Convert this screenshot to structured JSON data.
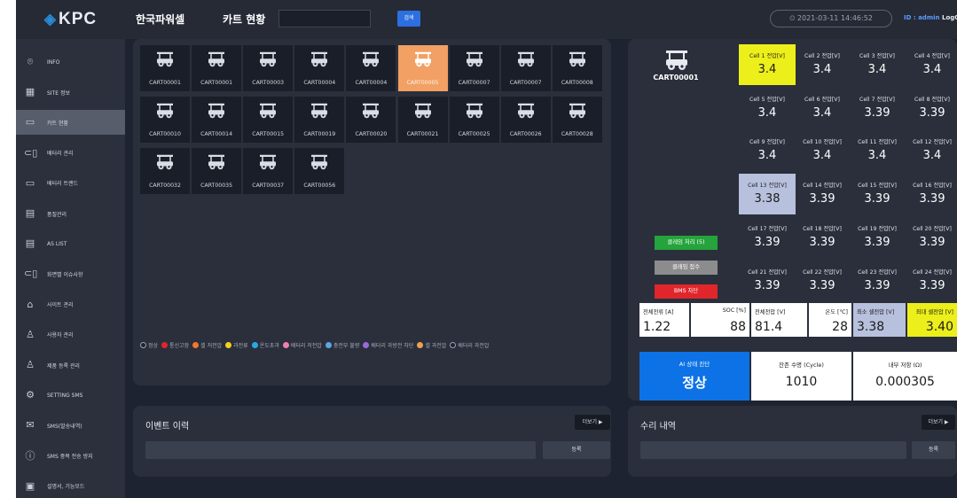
{
  "sidebar": {
    "logo": "KPC",
    "items": [
      {
        "label": "INFO",
        "icon": "location-pin-icon"
      },
      {
        "label": "SITE 정보",
        "icon": "building-icon"
      },
      {
        "label": "카트 현황",
        "icon": "monitor-icon"
      },
      {
        "label": "배터리 관리",
        "icon": "battery-signal-icon"
      },
      {
        "label": "배터리 트랜드",
        "icon": "battery-icon"
      },
      {
        "label": "품질관리",
        "icon": "clipboard-icon"
      },
      {
        "label": "AS LIST",
        "icon": "clipboard-list-icon"
      },
      {
        "label": "화면별 이슈사항",
        "icon": "battery-signal-icon"
      },
      {
        "label": "사이트 관리",
        "icon": "bank-icon"
      },
      {
        "label": "사용자 관리",
        "icon": "user-icon"
      },
      {
        "label": "제품 등록 관리",
        "icon": "user-edit-icon"
      },
      {
        "label": "SETTING SMS",
        "icon": "gear-icon"
      },
      {
        "label": "SMS(발송내역)",
        "icon": "mail-icon"
      },
      {
        "label": "SMS 중복 전송 방지",
        "icon": "info-circle-icon"
      },
      {
        "label": "설명서, 기능모드",
        "icon": "document-icon"
      }
    ]
  },
  "header": {
    "company": "한국파워셀",
    "page": "카트 현황",
    "search_value": "",
    "search_button": "검색",
    "datetime": "2021-03-11 14:46:52",
    "user": "ID : admin",
    "logout": "LogOut"
  },
  "carts": [
    "CART00001",
    "CART00001",
    "CART00003",
    "CART00004",
    "CART00004",
    "CART00005",
    "CART00007",
    "CART00007",
    "CART00008",
    "CART00010",
    "CART00014",
    "CART00015",
    "CART00019",
    "CART00020",
    "CART00021",
    "CART00025",
    "CART00026",
    "CART00028",
    "CART00032",
    "CART00035",
    "CART00037",
    "CART00056"
  ],
  "selected_cart_index": 5,
  "legend": [
    {
      "label": "정상",
      "color": "#1d2330",
      "border": "#9aa2b1"
    },
    {
      "label": "통신고장",
      "color": "#e0262b"
    },
    {
      "label": "셀 저전압",
      "color": "#f0782f"
    },
    {
      "label": "과전류",
      "color": "#f2d21c"
    },
    {
      "label": "온도초과",
      "color": "#2aa7e8"
    },
    {
      "label": "배터리 저전압",
      "color": "#f07fb0"
    },
    {
      "label": "충전부 불량",
      "color": "#5aa7e0"
    },
    {
      "label": "배터리 과방전 차단",
      "color": "#9b6ad8"
    },
    {
      "label": "셀 과전압",
      "color": "#f0a050"
    },
    {
      "label": "배터리 과전압",
      "color": "#1d2330",
      "border": "#9aa2b1"
    }
  ],
  "detail": {
    "cart_id": "CART00001",
    "cells": [
      {
        "label": "Cell 1 전압[V]",
        "value": "3.4",
        "highlight": "yellow"
      },
      {
        "label": "Cell 2 전압[V]",
        "value": "3.4"
      },
      {
        "label": "Cell 3 전압[V]",
        "value": "3.4"
      },
      {
        "label": "Cell 4 전압[V]",
        "value": "3.4"
      },
      {
        "label": "Cell 5 전압[V]",
        "value": "3.4"
      },
      {
        "label": "Cell 6 전압[V]",
        "value": "3.4"
      },
      {
        "label": "Cell 7 전압[V]",
        "value": "3.39"
      },
      {
        "label": "Cell 8 전압[V]",
        "value": "3.39"
      },
      {
        "label": "Cell 9 전압[V]",
        "value": "3.4"
      },
      {
        "label": "Cell 10 전압[V]",
        "value": "3.4"
      },
      {
        "label": "Cell 11 전압[V]",
        "value": "3.4"
      },
      {
        "label": "Cell 12 전압[V]",
        "value": "3.4"
      },
      {
        "label": "Cell 13 전압[V]",
        "value": "3.38",
        "highlight": "blue"
      },
      {
        "label": "Cell 14 전압[V]",
        "value": "3.39"
      },
      {
        "label": "Cell 15 전압[V]",
        "value": "3.39"
      },
      {
        "label": "Cell 16 전압[V]",
        "value": "3.39"
      },
      {
        "label": "Cell 17 전압[V]",
        "value": "3.39"
      },
      {
        "label": "Cell 18 전압[V]",
        "value": "3.39"
      },
      {
        "label": "Cell 19 전압[V]",
        "value": "3.39"
      },
      {
        "label": "Cell 20 전압[V]",
        "value": "3.39"
      },
      {
        "label": "Cell 21 전압[V]",
        "value": "3.39"
      },
      {
        "label": "Cell 22 전압[V]",
        "value": "3.39"
      },
      {
        "label": "Cell 23 전압[V]",
        "value": "3.39"
      },
      {
        "label": "Cell 24 전압[V]",
        "value": "3.39"
      }
    ],
    "buttons": {
      "claim": "클레임 처리 (5)",
      "receipt": "클레임 접수",
      "bms": "BMS 차단"
    },
    "summary": [
      {
        "label": "전체전류 [A]",
        "value": "1.22"
      },
      {
        "label": "SOC [%]",
        "value": "88"
      },
      {
        "label": "전체전압 [V]",
        "value": "81.4"
      },
      {
        "label": "온도 [℃]",
        "value": "28"
      },
      {
        "label": "최소 셀전압 [V]",
        "value": "3.38"
      },
      {
        "label": "최대 셀전압 [V]",
        "value": "3.40"
      }
    ],
    "ai": {
      "label": "AI 상태 진단",
      "value": "정상"
    },
    "life": {
      "label": "잔존 수명 (Cycle)",
      "value": "1010"
    },
    "resistance": {
      "label": "내부 저항 (Ω)",
      "value": "0.000305"
    }
  },
  "events": {
    "title": "이벤트 이력",
    "more": "더보기 ▶",
    "register": "등록"
  },
  "repairs": {
    "title": "수리 내역",
    "more": "더보기 ▶",
    "register": "등록"
  },
  "colors": {
    "accent": "#0d72e6",
    "selected_cart": "#f2a063",
    "max_cell": "#ecef1a",
    "min_cell": "#b7c0dc"
  }
}
